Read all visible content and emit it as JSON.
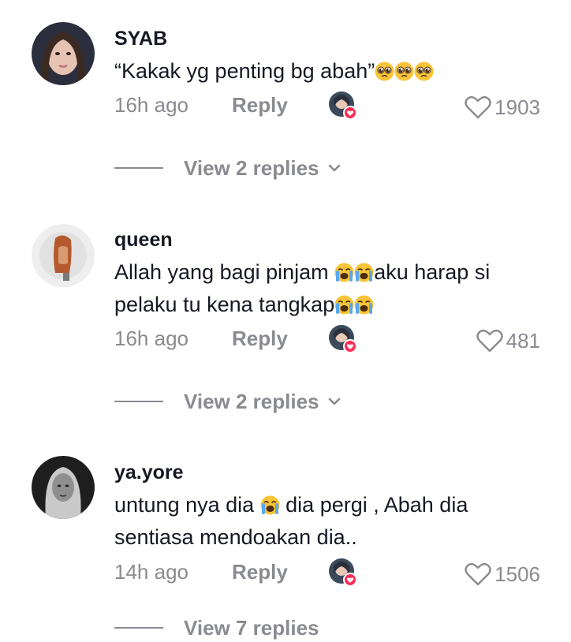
{
  "comments": [
    {
      "username": "SYAB",
      "text": "“Kakak yg penting bg abah”",
      "emojis": [
        "pleading-face",
        "pleading-face",
        "pleading-face"
      ],
      "timestamp": "16h ago",
      "reply_label": "Reply",
      "likes": "1903",
      "view_replies": "View 2 replies"
    },
    {
      "username": "queen",
      "text_before": "Allah yang bagi pinjam ",
      "text_mid": "aku harap si pelaku tu kena tangkap",
      "timestamp": "16h ago",
      "reply_label": "Reply",
      "likes": "481",
      "view_replies": "View 2 replies"
    },
    {
      "username": "ya.yore",
      "text_before": "untung nya dia ",
      "text_after": " dia pergi , Abah dia sentiasa mendoakan dia..",
      "timestamp": "14h ago",
      "reply_label": "Reply",
      "likes": "1506",
      "view_replies": "View 7 replies"
    }
  ],
  "colors": {
    "text_primary": "#161823",
    "text_secondary": "#8a8b91",
    "like_badge": "#fe2c55",
    "emoji_yellow": "#f7c43a"
  },
  "icons": {
    "like": "heart-outline-icon",
    "expand": "chevron-down-icon",
    "creator_liked": "creator-liked-avatar-badge",
    "emoji_pleading": "pleading-face-emoji",
    "emoji_crying": "loudly-crying-face-emoji"
  }
}
